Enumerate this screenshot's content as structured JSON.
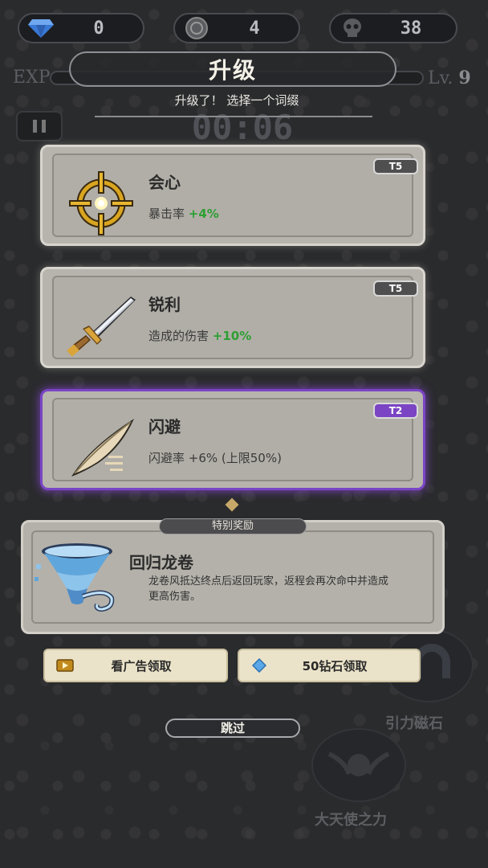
{
  "resources": {
    "gems": "0",
    "coins": "4",
    "kills": "38"
  },
  "exp": {
    "label": "EXP",
    "level_prefix": "Lv.",
    "level": "9",
    "progress": 0.0
  },
  "timer": "00:06",
  "dialog": {
    "title": "升级",
    "subtitle": "升级了！ 选择一个词缀"
  },
  "choices": [
    {
      "name": "会心",
      "stat": "暴击率",
      "bonus": "+4%",
      "tier": "T5",
      "icon": "crosshair-icon",
      "selected": false
    },
    {
      "name": "锐利",
      "stat": "造成的伤害",
      "bonus": "+10%",
      "tier": "T5",
      "icon": "sword-icon",
      "selected": false
    },
    {
      "name": "闪避",
      "stat": "闪避率 +6% (上限50%)",
      "bonus": "",
      "tier": "T2",
      "icon": "feather-icon",
      "selected": true
    }
  ],
  "special": {
    "tag": "特别奖励",
    "name": "回归龙卷",
    "desc": "龙卷风抵达终点后返回玩家，返程会再次命中并造成更高伤害。",
    "icon": "tornado-icon"
  },
  "buttons": {
    "ad": "看广告领取",
    "diamond": "50钻石领取",
    "skip": "跳过"
  },
  "background_skills": {
    "magnet": "引力磁石",
    "angel": "大天使之力"
  },
  "colors": {
    "accent_green": "#2d9f33",
    "selected_purple": "#7b44c4",
    "button_bg": "#ebe3c9"
  }
}
